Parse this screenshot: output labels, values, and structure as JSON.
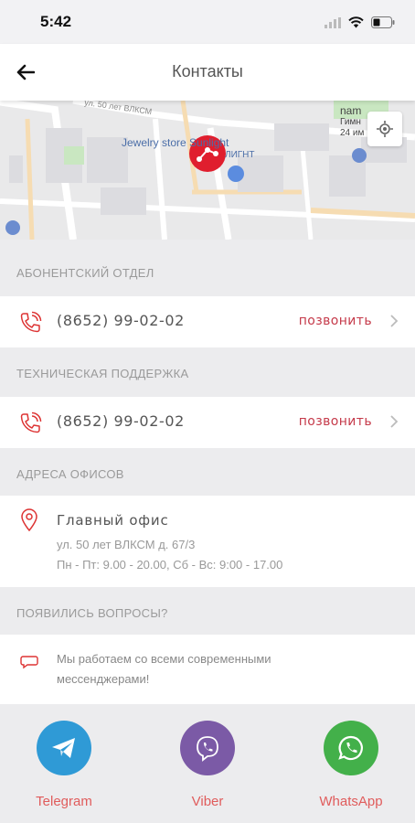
{
  "status_bar": {
    "time": "5:42"
  },
  "header": {
    "title": "Контакты"
  },
  "map": {
    "labels": [
      "Jewelry store Sunlight",
      "ЛИГНТ",
      "ул. 50 лет ВЛКСМ",
      "nam",
      "Гимн",
      "24 им"
    ]
  },
  "sections": {
    "subscriber": {
      "title": "АБОНЕНТСКИЙ ОТДЕЛ",
      "phone": "(8652) 99-02-02",
      "call_label": "позвонить"
    },
    "support": {
      "title": "ТЕХНИЧЕСКАЯ ПОДДЕРЖКА",
      "phone": "(8652) 99-02-02",
      "call_label": "позвонить"
    },
    "offices": {
      "title": "АДРЕСА ОФИСОВ",
      "name": "Главный офис",
      "address": "ул. 50 лет ВЛКСМ д. 67/3",
      "hours": "Пн - Пт: 9.00 - 20.00, Сб - Вс: 9:00 - 17.00"
    },
    "questions": {
      "title": "ПОЯВИЛИСЬ ВОПРОСЫ?",
      "text": "Мы работаем со всеми современными мессенджерами!"
    }
  },
  "messengers": [
    {
      "label": "Telegram",
      "color": "#2f9ad6"
    },
    {
      "label": "Viber",
      "color": "#7b5aa6"
    },
    {
      "label": "WhatsApp",
      "color": "#43b04a"
    }
  ],
  "colors": {
    "accent": "#c53a4a",
    "marker": "#e01e2e"
  }
}
